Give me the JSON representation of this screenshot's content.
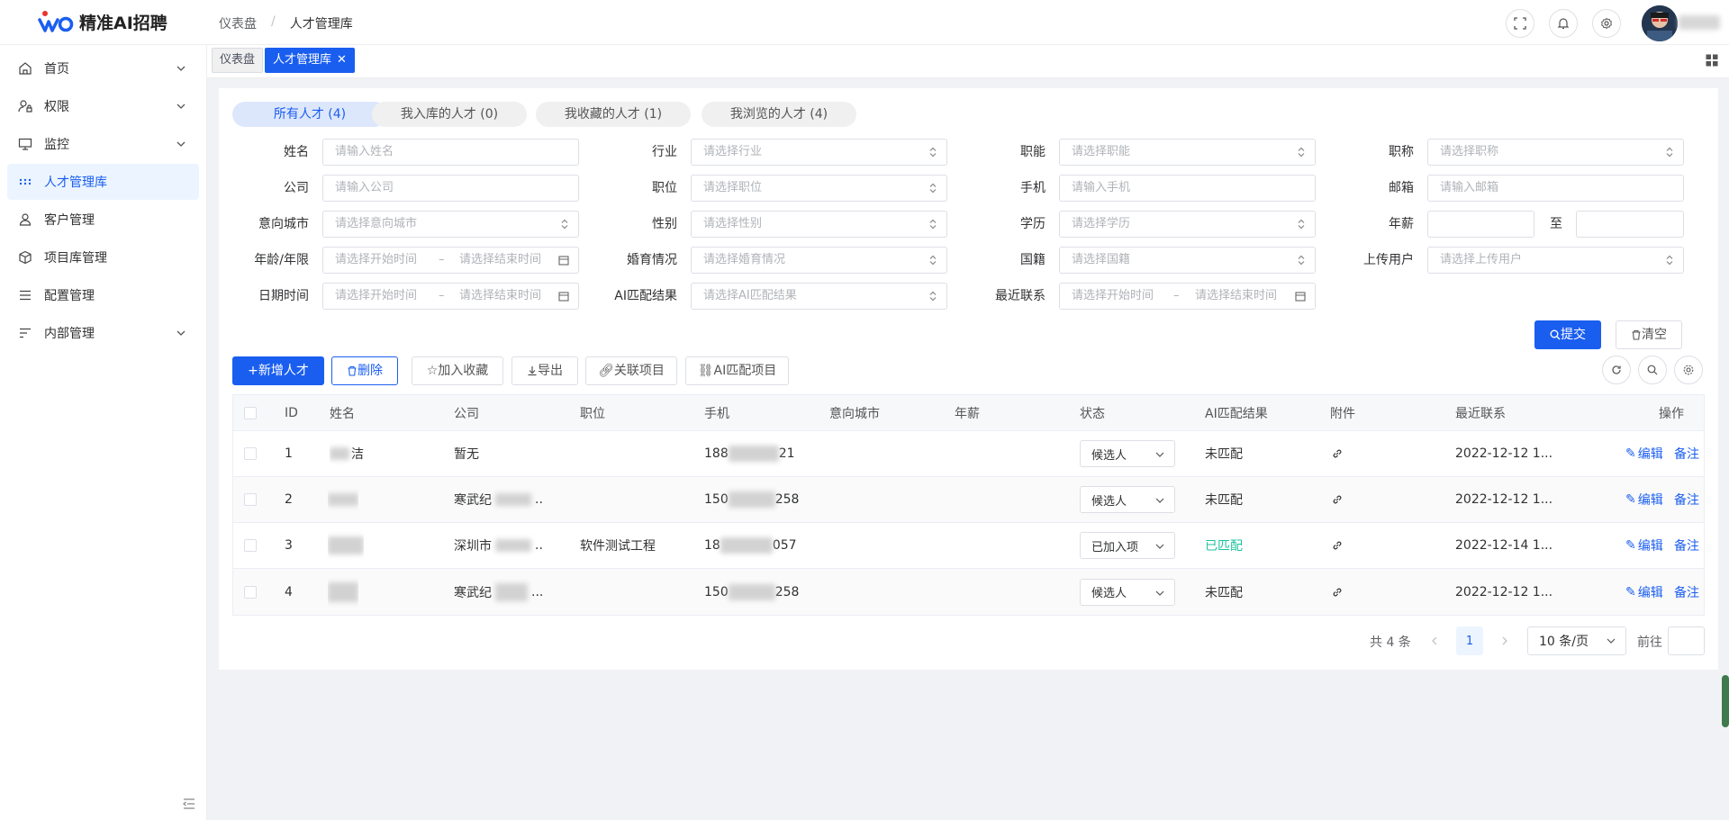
{
  "header": {
    "logo_text": "精准AI招聘",
    "breadcrumb": [
      "仪表盘",
      "人才管理库"
    ],
    "breadcrumb_sep": "/"
  },
  "sidebar": {
    "items": [
      {
        "label": "首页",
        "icon": "home-icon",
        "expandable": true
      },
      {
        "label": "权限",
        "icon": "user-lock-icon",
        "expandable": true
      },
      {
        "label": "监控",
        "icon": "monitor-icon",
        "expandable": true
      },
      {
        "label": "人才管理库",
        "icon": "dots-icon",
        "expandable": false,
        "active": true
      },
      {
        "label": "客户管理",
        "icon": "person-icon",
        "expandable": false
      },
      {
        "label": "项目库管理",
        "icon": "cube-icon",
        "expandable": false
      },
      {
        "label": "配置管理",
        "icon": "list-icon",
        "expandable": false
      },
      {
        "label": "内部管理",
        "icon": "sort-icon",
        "expandable": true
      }
    ]
  },
  "tabs": [
    {
      "label": "仪表盘"
    },
    {
      "label": "人才管理库",
      "active": true,
      "close": "✕"
    }
  ],
  "categories": [
    "所有人才 (4)",
    "我入库的人才 (0)",
    "我收藏的人才 (1)",
    "我浏览的人才 (4)"
  ],
  "filters": {
    "name": {
      "label": "姓名",
      "placeholder": "请输入姓名"
    },
    "industry": {
      "label": "行业",
      "placeholder": "请选择行业"
    },
    "function": {
      "label": "职能",
      "placeholder": "请选择职能"
    },
    "title": {
      "label": "职称",
      "placeholder": "请选择职称"
    },
    "company": {
      "label": "公司",
      "placeholder": "请输入公司"
    },
    "position": {
      "label": "职位",
      "placeholder": "请选择职位"
    },
    "phone": {
      "label": "手机",
      "placeholder": "请输入手机"
    },
    "email": {
      "label": "邮箱",
      "placeholder": "请输入邮箱"
    },
    "city": {
      "label": "意向城市",
      "placeholder": "请选择意向城市"
    },
    "gender": {
      "label": "性别",
      "placeholder": "请选择性别"
    },
    "education": {
      "label": "学历",
      "placeholder": "请选择学历"
    },
    "salary": {
      "label": "年薪",
      "to": "至"
    },
    "age": {
      "label": "年龄/年限",
      "start": "请选择开始时间",
      "end": "请选择结束时间",
      "dash": "–"
    },
    "marriage": {
      "label": "婚育情况",
      "placeholder": "请选择婚育情况"
    },
    "nationality": {
      "label": "国籍",
      "placeholder": "请选择国籍"
    },
    "uploader": {
      "label": "上传用户",
      "placeholder": "请选择上传用户"
    },
    "date": {
      "label": "日期时间",
      "start": "请选择开始时间",
      "end": "请选择结束时间",
      "dash": "–"
    },
    "ai_result": {
      "label": "AI匹配结果",
      "placeholder": "请选择AI匹配结果"
    },
    "last_contact": {
      "label": "最近联系",
      "start": "请选择开始时间",
      "end": "请选择结束时间",
      "dash": "–"
    }
  },
  "buttons": {
    "submit": "提交",
    "clear": "清空",
    "add": "新增人才",
    "delete": "删除",
    "favorite": "加入收藏",
    "export": "导出",
    "link_project": "关联项目",
    "ai_match": "AI匹配项目",
    "edit": "编辑",
    "note": "备注"
  },
  "table": {
    "columns": [
      "ID",
      "姓名",
      "公司",
      "职位",
      "手机",
      "意向城市",
      "年薪",
      "状态",
      "AI匹配结果",
      "附件",
      "最近联系",
      "操作"
    ],
    "rows": [
      {
        "id": "1",
        "name": "洁",
        "company": "暂无",
        "position": "",
        "phone_a": "188",
        "phone_b": "21",
        "status": "候选人",
        "ai": "未匹配",
        "ai_matched": false,
        "last": "2022-12-12 1..."
      },
      {
        "id": "2",
        "name": "",
        "company": "寒武纪",
        "company_tail": "..",
        "position": "",
        "phone_a": "150",
        "phone_b": "258",
        "status": "候选人",
        "ai": "未匹配",
        "ai_matched": false,
        "last": "2022-12-12 1..."
      },
      {
        "id": "3",
        "name": "",
        "company": "深圳市",
        "company_tail": "..",
        "position": "软件测试工程",
        "phone_a": "18",
        "phone_b": "057",
        "status": "已加入项",
        "ai": "已匹配",
        "ai_matched": true,
        "last": "2022-12-14 1..."
      },
      {
        "id": "4",
        "name": "",
        "company": "寒武纪",
        "company_tail": "...",
        "position": "",
        "phone_a": "150",
        "phone_b": "258",
        "status": "候选人",
        "ai": "未匹配",
        "ai_matched": false,
        "last": "2022-12-12 1..."
      }
    ]
  },
  "pagination": {
    "total": "共 4 条",
    "current": "1",
    "page_size": "10 条/页",
    "goto": "前往"
  },
  "colors": {
    "primary": "#1a5ef0",
    "matched": "#1cc3a0"
  }
}
